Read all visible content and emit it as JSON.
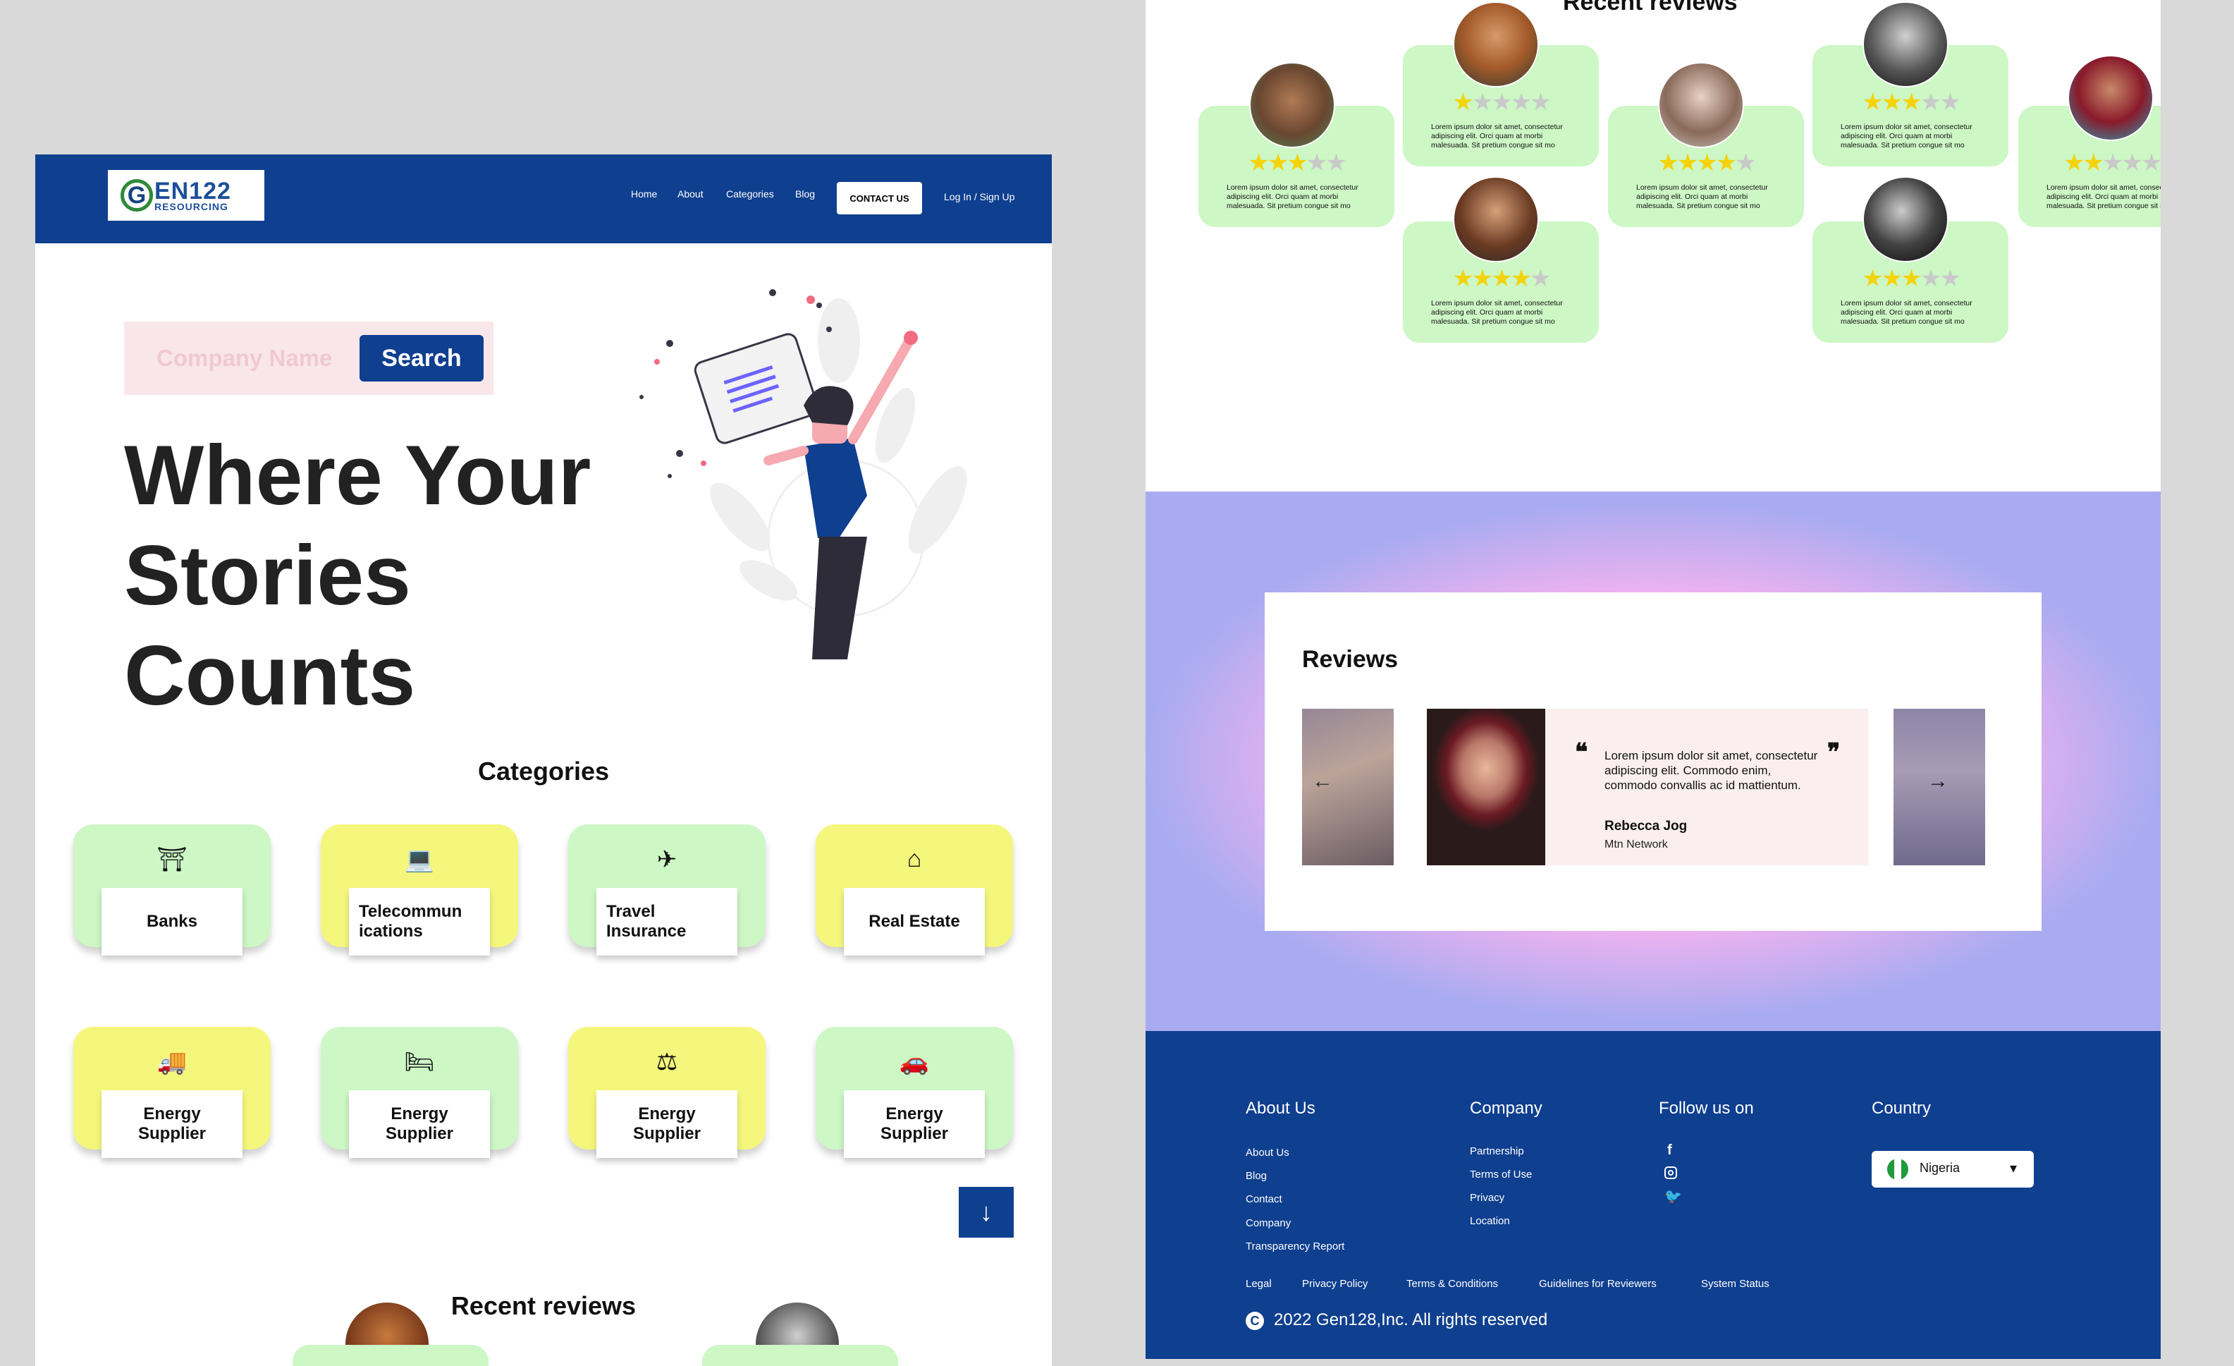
{
  "colors": {
    "brand_blue": "#0f3f8f",
    "card_green": "#cdf7c5",
    "card_yellow": "#f5f77c",
    "star": "#f4d30b"
  },
  "nav": {
    "logo_g": "G",
    "logo_line1": "EN122",
    "logo_line2": "RESOURCING",
    "links": [
      "Home",
      "About",
      "Categories",
      "Blog"
    ],
    "contact": "CONTACT US",
    "login": "Log In / Sign Up"
  },
  "search": {
    "placeholder": "Company Name",
    "button": "Search"
  },
  "hero": {
    "line1": "Where Your",
    "line2": "Stories",
    "line3": "Counts"
  },
  "categories": {
    "title": "Categories",
    "items": [
      {
        "label": "Banks",
        "icon": "bank-icon"
      },
      {
        "label": "Telecommun ications",
        "icon": "laptop-icon"
      },
      {
        "label": "Travel Insurance",
        "icon": "plane-icon"
      },
      {
        "label": "Real Estate",
        "icon": "house-icon"
      },
      {
        "label": "Energy Supplier",
        "icon": "truck-icon"
      },
      {
        "label": "Energy Supplier",
        "icon": "bed-icon"
      },
      {
        "label": "Energy Supplier",
        "icon": "scale-icon"
      },
      {
        "label": "Energy Supplier",
        "icon": "car-icon"
      }
    ]
  },
  "recent_reviews": {
    "title": "Recent reviews",
    "text": "Lorem ipsum dolor sit amet, consectetur adipiscing elit. Orci quam at morbi malesuada. Sit pretium congue sit mo",
    "ratings": [
      3,
      1,
      4,
      3,
      2,
      4,
      3
    ]
  },
  "reviews": {
    "title": "Reviews",
    "quote": "Lorem ipsum dolor sit amet, consectetur adipiscing elit. Commodo enim, commodo convallis ac id mattientum.",
    "name": "Rebecca Jog",
    "company": "Mtn Network",
    "open_quote": "❝",
    "close_quote": "❞"
  },
  "footer": {
    "about": {
      "title": "About Us",
      "links": [
        "About Us",
        "Blog",
        "Contact",
        "Company",
        "Transparency Report"
      ]
    },
    "company": {
      "title": "Company",
      "links": [
        "Partnership",
        "Terms of Use",
        "Privacy",
        "Location"
      ]
    },
    "follow": {
      "title": "Follow us on",
      "icons": [
        "facebook-icon",
        "instagram-icon",
        "twitter-icon"
      ]
    },
    "country": {
      "title": "Country",
      "selected": "Nigeria"
    },
    "bottom_links": [
      "Legal",
      "Privacy Policy",
      "Terms & Conditions",
      "Guidelines for Reviewers",
      "System Status"
    ],
    "copyright": "2022 Gen128,Inc. All rights reserved"
  }
}
